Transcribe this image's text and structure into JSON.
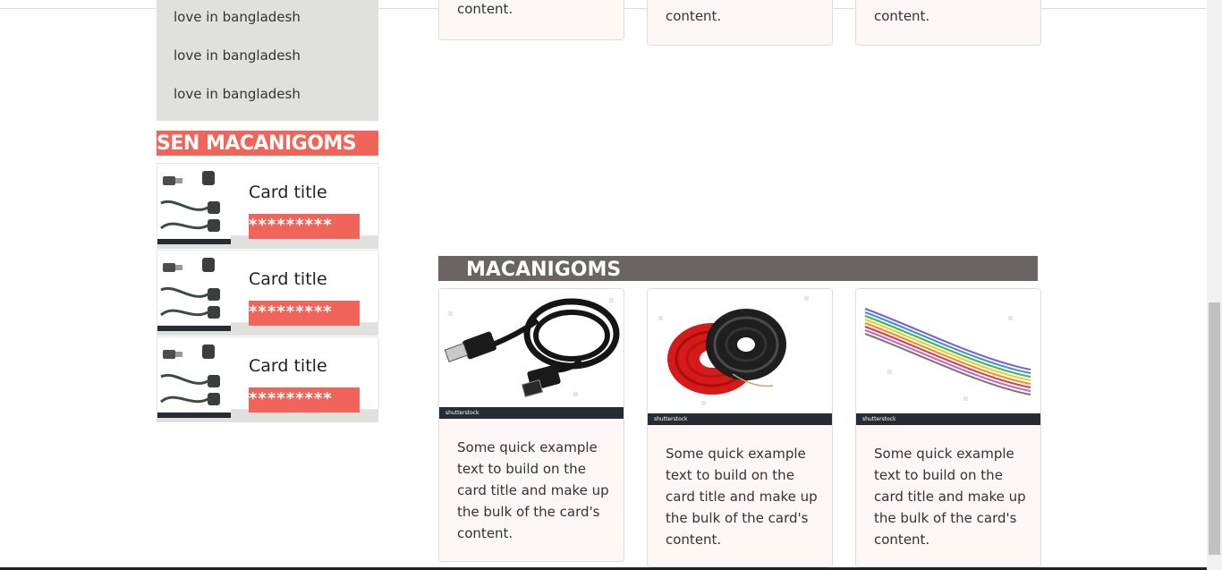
{
  "sidebar": {
    "list_items": [
      "love in bangladesh",
      "love in bangladesh",
      "love in bangladesh"
    ],
    "heading": "SEN MACANIGOMS",
    "cards": [
      {
        "title": "Card title",
        "rating": "*********",
        "image_icon": "plug-cable-icon"
      },
      {
        "title": "Card title",
        "rating": "*********",
        "image_icon": "plug-cable-icon"
      },
      {
        "title": "Card title",
        "rating": "*********",
        "image_icon": "plug-cable-icon"
      }
    ]
  },
  "top_cards": [
    {
      "text": "content."
    },
    {
      "text": "content."
    },
    {
      "text": "content."
    }
  ],
  "main": {
    "heading": "MACANIGOMS",
    "cards": [
      {
        "image_icon": "usb-cable-icon",
        "watermark": "shutterstock",
        "text": "Some quick example text to build on the card title and make up the bulk of the card's content."
      },
      {
        "image_icon": "wire-coil-icon",
        "watermark": "shutterstock",
        "text": "Some quick example text to build on the card title and make up the bulk of the card's content."
      },
      {
        "image_icon": "jumper-wires-icon",
        "watermark": "shutterstock",
        "text": "Some quick example text to build on the card title and make up the bulk of the card's content."
      }
    ]
  },
  "colors": {
    "accent_red": "#f0645a",
    "heading_gray": "#6b6464",
    "sidebar_bg": "#e0e0de"
  }
}
